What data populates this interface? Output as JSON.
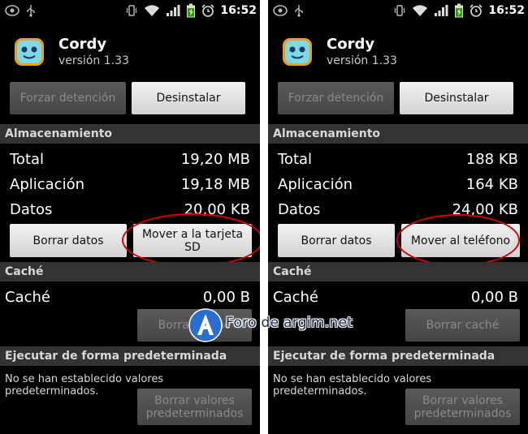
{
  "status_bar": {
    "time": "16:52"
  },
  "screens": [
    {
      "app": {
        "name": "Cordy",
        "version": "versión 1.33"
      },
      "buttons": {
        "force_stop": "Forzar detención",
        "uninstall": "Desinstalar"
      },
      "storage": {
        "header": "Almacenamiento",
        "rows": [
          {
            "label": "Total",
            "value": "19,20 MB"
          },
          {
            "label": "Aplicación",
            "value": "19,18 MB"
          },
          {
            "label": "Datos",
            "value": "20,00 KB"
          }
        ],
        "clear_data": "Borrar datos",
        "move": "Mover a la tarjeta SD"
      },
      "cache": {
        "header": "Caché",
        "label": "Caché",
        "value": "0,00 B",
        "clear": "Borrar caché"
      },
      "defaults": {
        "header": "Ejecutar de forma predeterminada",
        "text": "No se han establecido valores predeterminados.",
        "clear_line1": "Borrar valores",
        "clear_line2": "predeterminados"
      }
    },
    {
      "app": {
        "name": "Cordy",
        "version": "versión 1.33"
      },
      "buttons": {
        "force_stop": "Forzar detención",
        "uninstall": "Desinstalar"
      },
      "storage": {
        "header": "Almacenamiento",
        "rows": [
          {
            "label": "Total",
            "value": "188 KB"
          },
          {
            "label": "Aplicación",
            "value": "164 KB"
          },
          {
            "label": "Datos",
            "value": "24,00 KB"
          }
        ],
        "clear_data": "Borrar datos",
        "move": "Mover al teléfono"
      },
      "cache": {
        "header": "Caché",
        "label": "Caché",
        "value": "0,00 B",
        "clear": "Borrar caché"
      },
      "defaults": {
        "header": "Ejecutar de forma predeterminada",
        "text": "No se han establecido valores predeterminados.",
        "clear_line1": "Borrar valores",
        "clear_line2": "predeterminados"
      }
    }
  ],
  "watermark": {
    "text": "Foro de argim.net"
  },
  "colors": {
    "highlight": "#d40000",
    "section_header_bg": "#333333",
    "background": "#000000"
  },
  "icons": [
    "debug-icon",
    "usb-icon",
    "vibrate-icon",
    "wifi-icon",
    "signal-icon",
    "battery-charging-icon",
    "alarm-icon",
    "app-robot-icon"
  ]
}
